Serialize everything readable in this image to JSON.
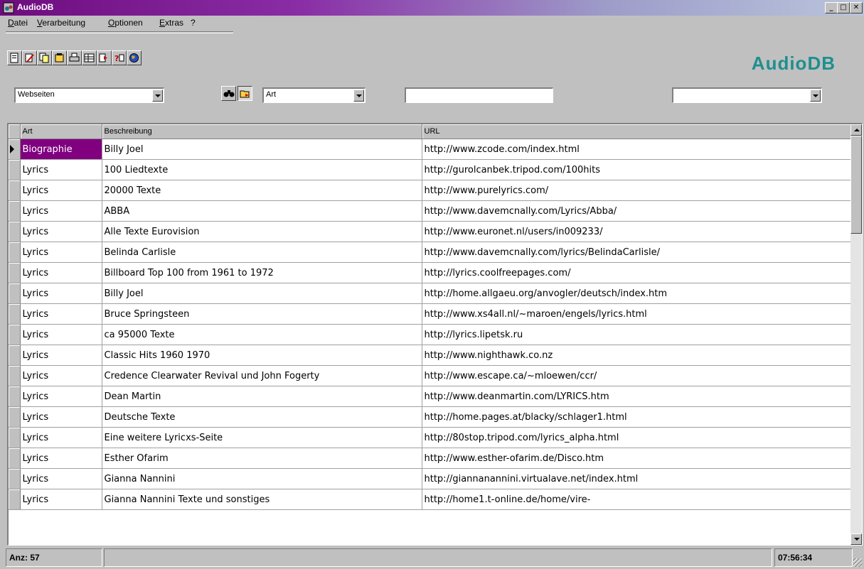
{
  "window": {
    "title": "AudioDB",
    "min_label": "_",
    "max_label": "□",
    "close_label": "✕"
  },
  "menu": [
    "Datei",
    "Verarbeitung",
    "Optionen",
    "Extras",
    "?"
  ],
  "toolbar": {
    "icons": [
      "new-record-icon",
      "edit-icon",
      "copy-icon",
      "database-icon",
      "print-icon",
      "table-icon",
      "export-icon",
      "help-icon",
      "globe-icon"
    ]
  },
  "brand": "AudioDB",
  "filters": {
    "category": "Webseiten",
    "field": "Art",
    "search": "",
    "value": ""
  },
  "grid": {
    "columns": [
      "Art",
      "Beschreibung",
      "URL"
    ],
    "rows": [
      {
        "art": "Biographie",
        "beschreibung": "Billy Joel",
        "url": "http://www.zcode.com/index.html"
      },
      {
        "art": "Lyrics",
        "beschreibung": "100 Liedtexte",
        "url": "http://gurolcanbek.tripod.com/100hits"
      },
      {
        "art": "Lyrics",
        "beschreibung": "20000 Texte",
        "url": "http://www.purelyrics.com/"
      },
      {
        "art": "Lyrics",
        "beschreibung": "ABBA",
        "url": "http://www.davemcnally.com/Lyrics/Abba/"
      },
      {
        "art": "Lyrics",
        "beschreibung": "Alle Texte Eurovision",
        "url": "http://www.euronet.nl/users/in009233/"
      },
      {
        "art": "Lyrics",
        "beschreibung": "Belinda Carlisle",
        "url": "http://www.davemcnally.com/lyrics/BelindaCarlisle/"
      },
      {
        "art": "Lyrics",
        "beschreibung": "Billboard Top 100 from 1961 to 1972",
        "url": "http://lyrics.coolfreepages.com/"
      },
      {
        "art": "Lyrics",
        "beschreibung": "Billy Joel",
        "url": "http://home.allgaeu.org/anvogler/deutsch/index.htm"
      },
      {
        "art": "Lyrics",
        "beschreibung": "Bruce Springsteen",
        "url": "http://www.xs4all.nl/~maroen/engels/lyrics.html"
      },
      {
        "art": "Lyrics",
        "beschreibung": "ca 95000 Texte",
        "url": "http://lyrics.lipetsk.ru"
      },
      {
        "art": "Lyrics",
        "beschreibung": "Classic Hits 1960 1970",
        "url": "http://www.nighthawk.co.nz"
      },
      {
        "art": "Lyrics",
        "beschreibung": "Credence Clearwater Revival und John Fogerty",
        "url": "http://www.escape.ca/~mloewen/ccr/"
      },
      {
        "art": "Lyrics",
        "beschreibung": "Dean Martin",
        "url": "http://www.deanmartin.com/LYRICS.htm"
      },
      {
        "art": "Lyrics",
        "beschreibung": "Deutsche Texte",
        "url": "http://home.pages.at/blacky/schlager1.html"
      },
      {
        "art": "Lyrics",
        "beschreibung": "Eine weitere Lyricxs-Seite",
        "url": "http://80stop.tripod.com/lyrics_alpha.html"
      },
      {
        "art": "Lyrics",
        "beschreibung": "Esther Ofarim",
        "url": "http://www.esther-ofarim.de/Disco.htm"
      },
      {
        "art": "Lyrics",
        "beschreibung": "Gianna Nannini",
        "url": "http://giannanannini.virtualave.net/index.html"
      },
      {
        "art": "Lyrics",
        "beschreibung": "Gianna Nannini Texte und sonstiges",
        "url": "http://home1.t-online.de/home/vire-"
      }
    ]
  },
  "status": {
    "count": "Anz: 57",
    "middle": "",
    "time": "07:56:34"
  },
  "colors": {
    "accent": "#1f8f8f",
    "selection": "#800080"
  }
}
